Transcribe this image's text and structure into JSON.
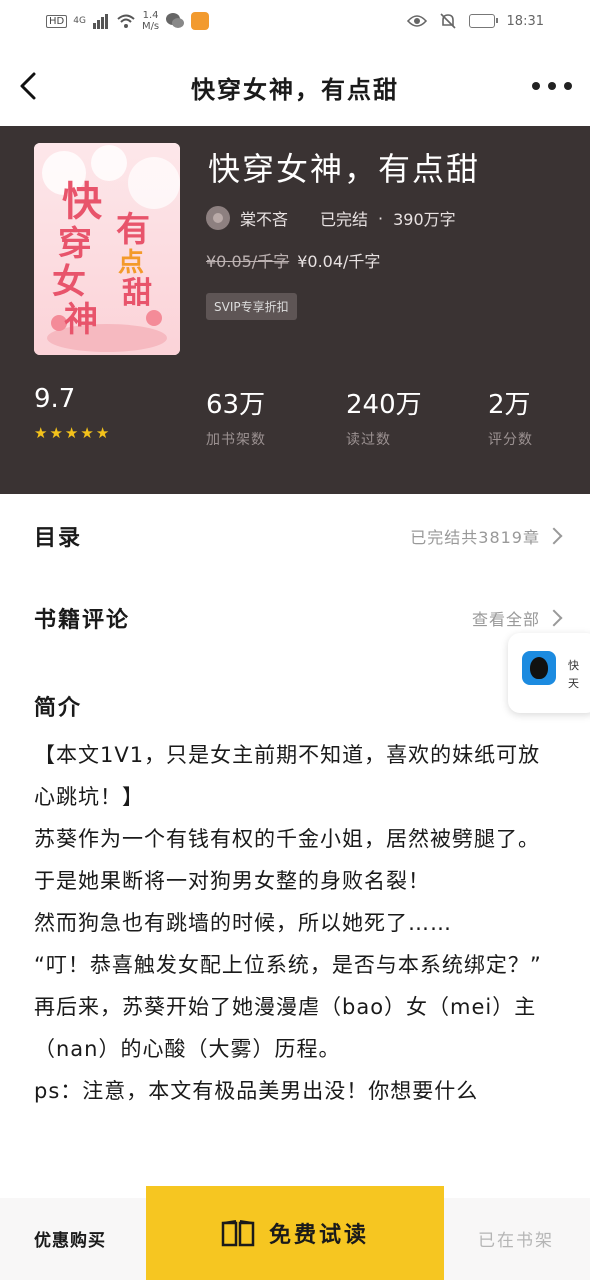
{
  "status_bar": {
    "hd": "HD",
    "network": "4G",
    "speed_value": "1.4",
    "speed_unit": "M/s",
    "time": "18:31",
    "icons": [
      "signal-icon",
      "wifi-icon",
      "wechat-icon",
      "app-icon",
      "eye-icon",
      "mute-icon",
      "battery-icon"
    ]
  },
  "nav": {
    "title": "快穿女神，有点甜",
    "back_icon": "back-arrow-icon",
    "more_icon": "more-dots-icon"
  },
  "book": {
    "title": "快穿女神，有点甜",
    "author": "棠不吝",
    "status": "已完结",
    "separator": "·",
    "word_count": "390万字",
    "price_old": "¥0.05/千字",
    "price_new": "¥0.04/千字",
    "badge": "SVIP专享折扣",
    "cover_text": [
      "快",
      "穿",
      "女",
      "神",
      "有",
      "点",
      "甜"
    ]
  },
  "stats": [
    {
      "value": "9.7",
      "label": "",
      "stars": 5
    },
    {
      "value": "63万",
      "label": "加书架数"
    },
    {
      "value": "240万",
      "label": "读过数"
    },
    {
      "value": "2万",
      "label": "评分数"
    }
  ],
  "toc": {
    "label": "目录",
    "right": "已完结共3819章"
  },
  "reviews": {
    "label": "书籍评论",
    "right": "查看全部"
  },
  "floating": {
    "line1": "快",
    "line2": "天"
  },
  "intro": {
    "label": "简介",
    "paragraphs": [
      "【本文1V1，只是女主前期不知道，喜欢的妹纸可放心跳坑！】",
      "苏葵作为一个有钱有权的千金小姐，居然被劈腿了。于是她果断将一对狗男女整的身败名裂！",
      "然而狗急也有跳墙的时候，所以她死了……",
      "“叮！恭喜触发女配上位系统，是否与本系统绑定？”",
      "再后来，苏葵开始了她漫漫虐（bao）女（mei）主（nan）的心酸（大雾）历程。",
      "ps：注意，本文有极品美男出没！你想要什么"
    ]
  },
  "bottom": {
    "buy": "优惠购买",
    "trial": "免费试读",
    "in_shelf": "已在书架"
  },
  "colors": {
    "header_bg": "#3a3333",
    "accent_yellow": "#f6c621",
    "star": "#f3c21b"
  }
}
